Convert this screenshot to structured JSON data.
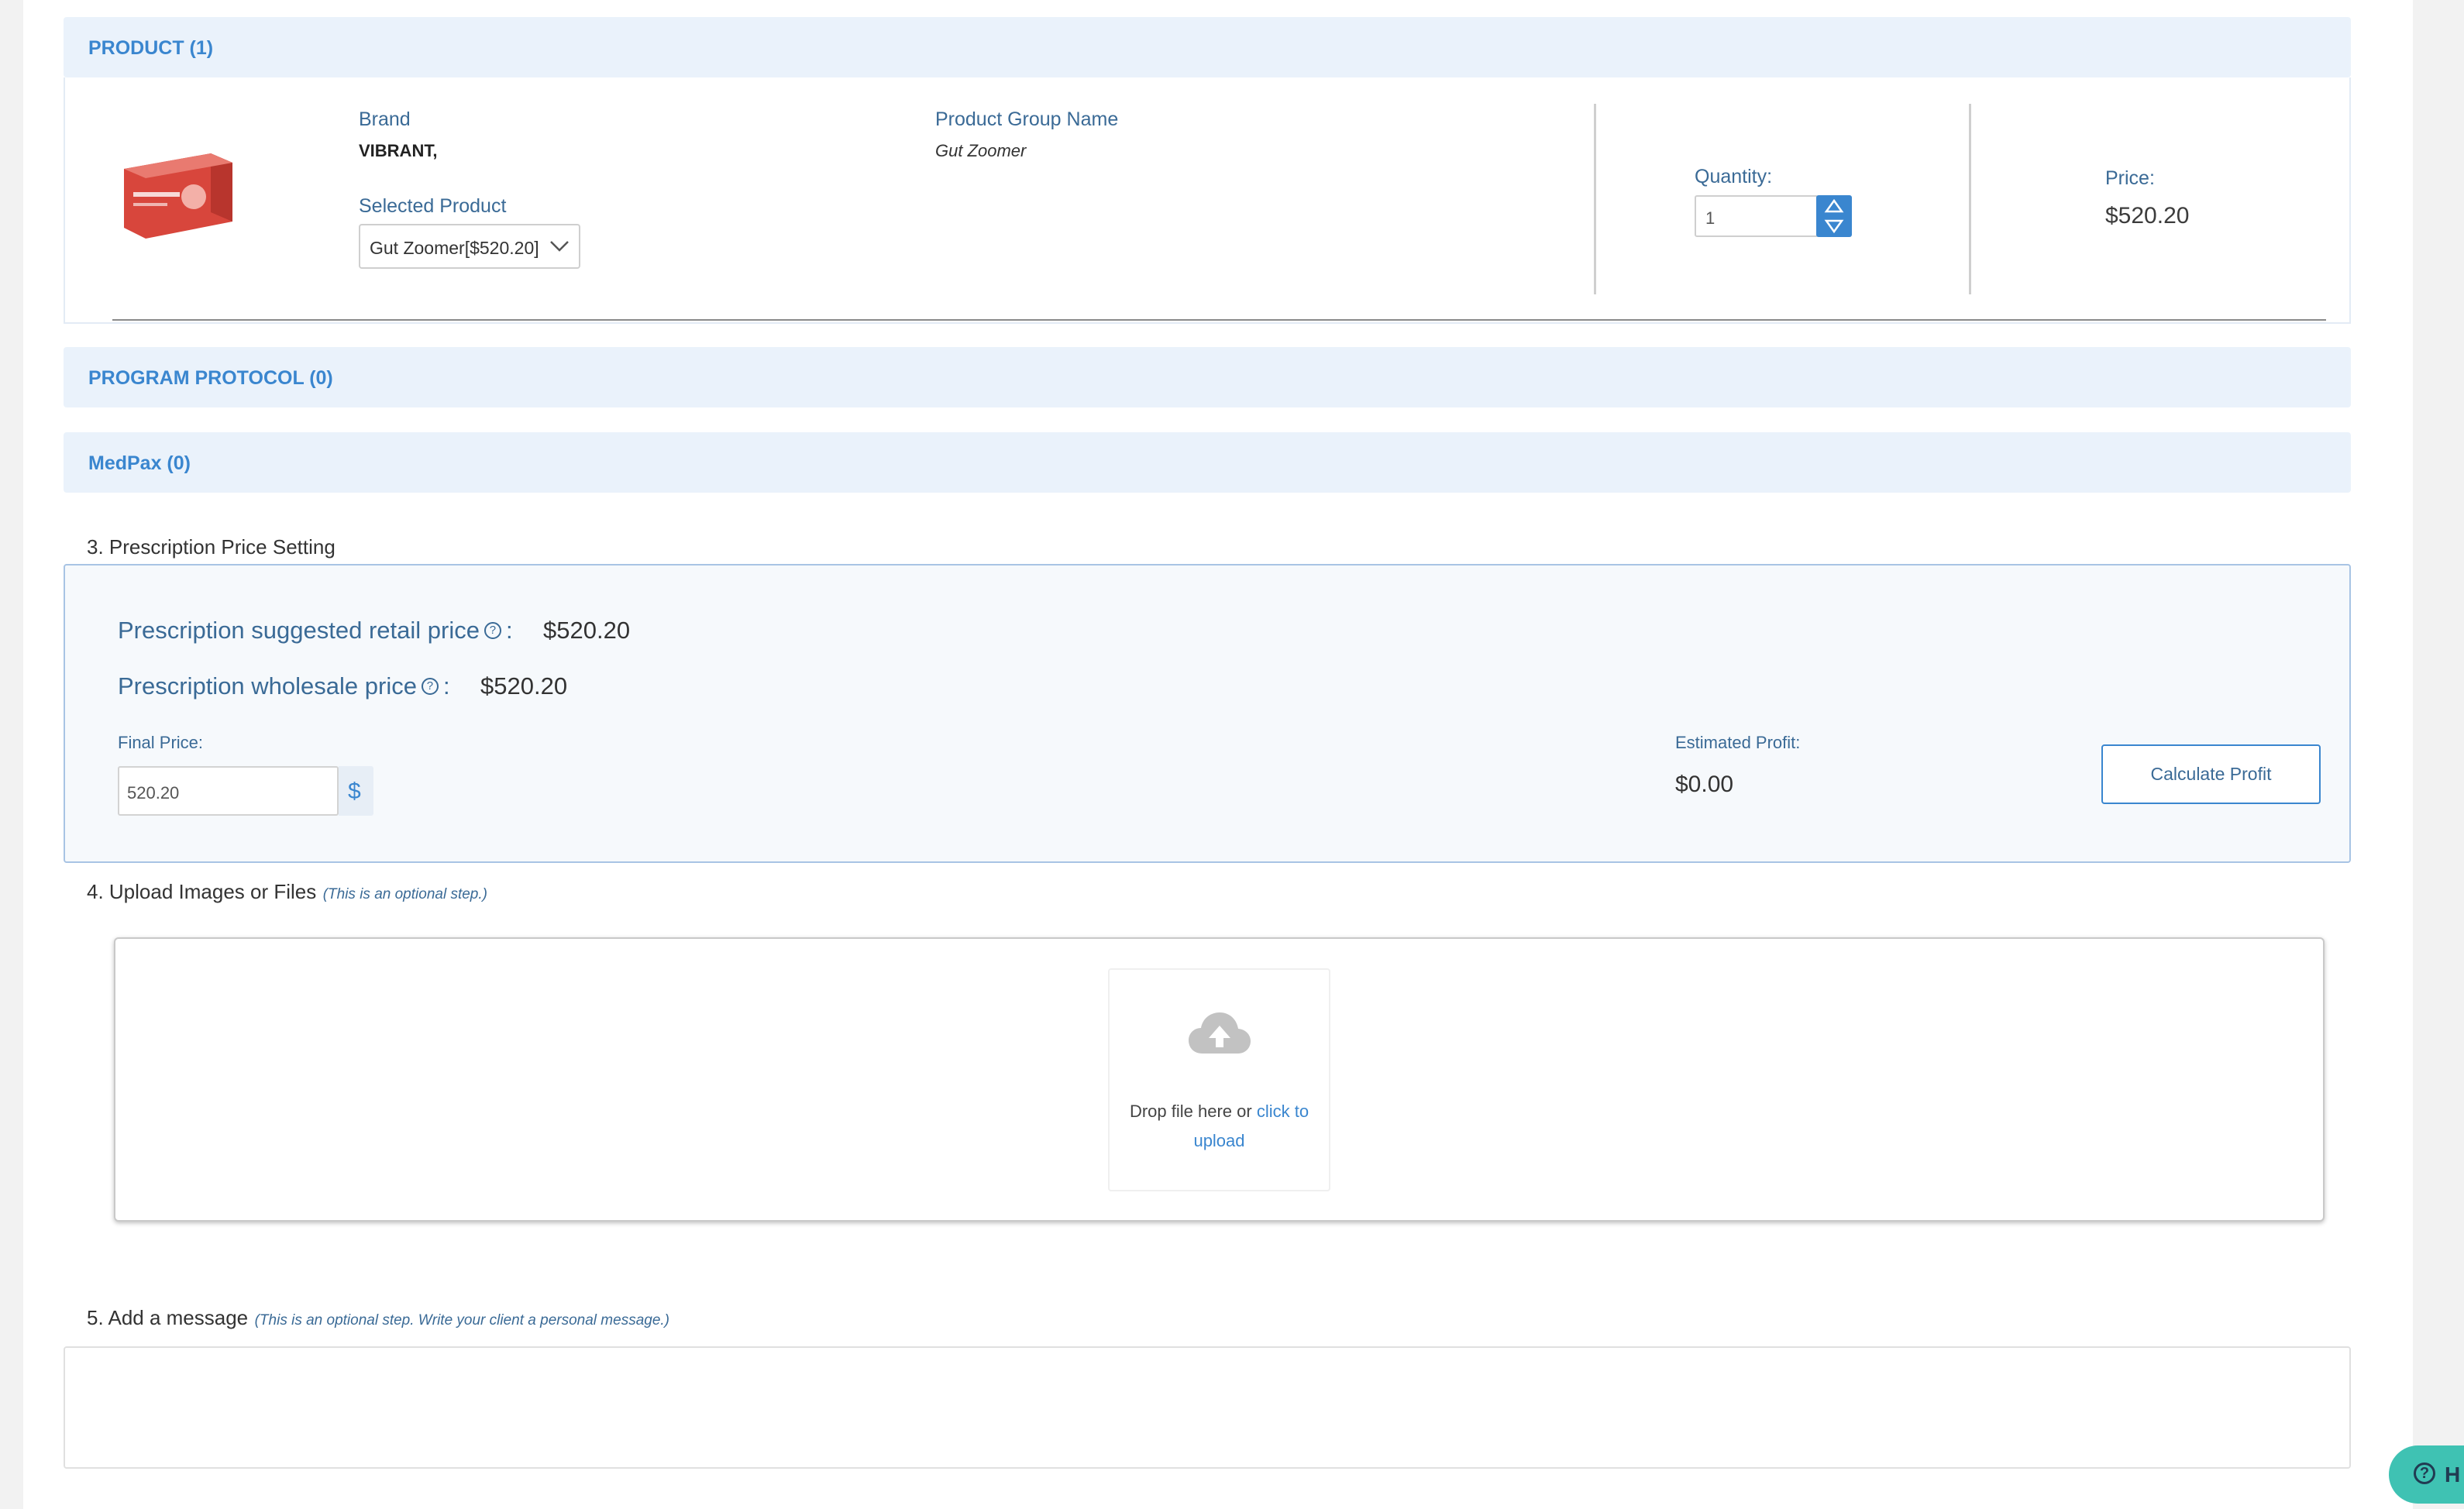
{
  "product_section": {
    "title": "PRODUCT (1)",
    "brand_label": "Brand",
    "brand_value": "VIBRANT,",
    "group_label": "Product Group Name",
    "group_value": "Gut Zoomer",
    "selected_label": "Selected Product",
    "selected_value": "Gut Zoomer[$520.20]",
    "quantity_label": "Quantity:",
    "quantity_value": "1",
    "price_label": "Price:",
    "price_value": "$520.20",
    "image_icon": "product-box-image"
  },
  "program_protocol": {
    "title": "PROGRAM PROTOCOL (0)"
  },
  "medpax": {
    "title": "MedPax (0)"
  },
  "price_setting": {
    "heading": "3. Prescription Price Setting",
    "retail_label": "Prescription suggested retail price",
    "retail_value": "$520.20",
    "wholesale_label": "Prescription wholesale price",
    "wholesale_value": "$520.20",
    "colon": ":",
    "help_glyph": "?",
    "final_label": "Final Price:",
    "final_value": "520.20",
    "currency": "$",
    "profit_label": "Estimated Profit:",
    "profit_value": "$0.00",
    "calc_button": "Calculate Profit"
  },
  "upload": {
    "heading": "4. Upload Images or Files",
    "hint": "(This is an optional step.)",
    "drop_text": "Drop file here or",
    "click_text_1": "click to",
    "click_text_2": "upload",
    "icon": "cloud-upload-icon"
  },
  "message": {
    "heading": "5. Add a message",
    "hint": "(This is an optional step. Write your client a personal message.)"
  },
  "help": {
    "label": "H",
    "glyph": "?"
  },
  "colors": {
    "accent": "#3a86cf",
    "header_bg": "#eaf2fb",
    "label_blue": "#3a6a96",
    "help_teal": "#3fc2b3"
  }
}
